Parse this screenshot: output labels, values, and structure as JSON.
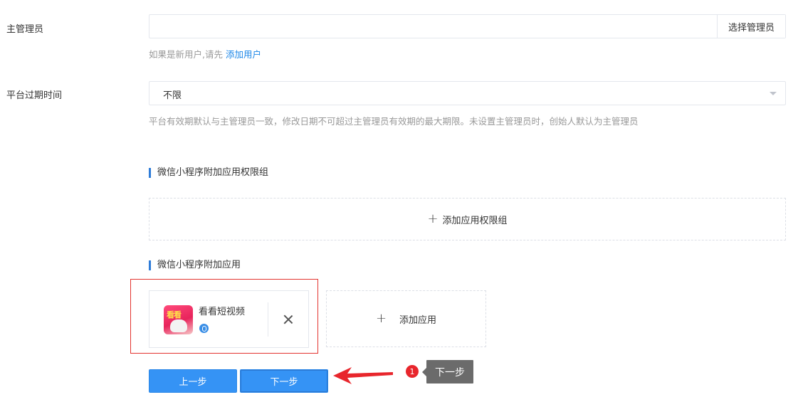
{
  "form": {
    "admin": {
      "label": "主管理员",
      "value": "",
      "select_button": "选择管理员",
      "hint_prefix": "如果是新用户,请先",
      "hint_link": "添加用户"
    },
    "expiry": {
      "label": "平台过期时间",
      "value": "不限",
      "hint": "平台有效期默认与主管理员一致，修改日期不可超过主管理员有效期的最大期限。未设置主管理员时，创始人默认为主管理员"
    }
  },
  "permission_groups": {
    "title": "微信小程序附加应用权限组",
    "add_label": "添加应用权限组"
  },
  "apps": {
    "title": "微信小程序附加应用",
    "items": [
      {
        "name": "看看短视频",
        "icon": "app-icon-kankan",
        "icon_text": "看看"
      }
    ],
    "add_label": "添加应用"
  },
  "buttons": {
    "prev": "上一步",
    "next": "下一步"
  },
  "guide": {
    "step_number": "1",
    "tooltip": "下一步",
    "highlight_color": "#e3342f",
    "arrow_color": "#e8262c"
  },
  "colors": {
    "primary": "#3593f5",
    "link": "#1a86e8",
    "section_bar": "#2f7cd8"
  }
}
